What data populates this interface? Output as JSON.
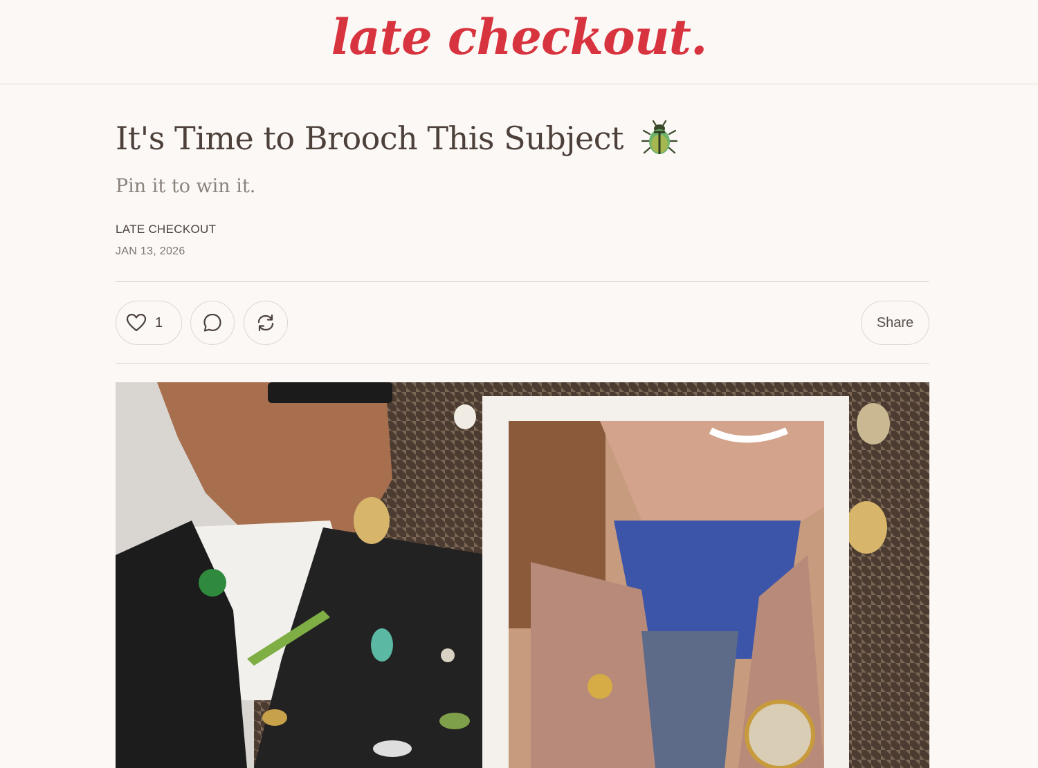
{
  "publication": {
    "name": "late checkout."
  },
  "post": {
    "title": "It's Time to Brooch This Subject",
    "title_emoji": "beetle-icon",
    "subtitle": "Pin it to win it.",
    "author": "LATE CHECKOUT",
    "date": "JAN 13, 2026"
  },
  "actions": {
    "like_count": "1",
    "share_label": "Share"
  },
  "colors": {
    "brand": "#d8343f",
    "background": "#fbf8f5",
    "text": "#4d403a",
    "muted": "#8a827d",
    "border": "#ddd7d2"
  },
  "icons": [
    "heart-icon",
    "comment-icon",
    "restack-icon"
  ]
}
